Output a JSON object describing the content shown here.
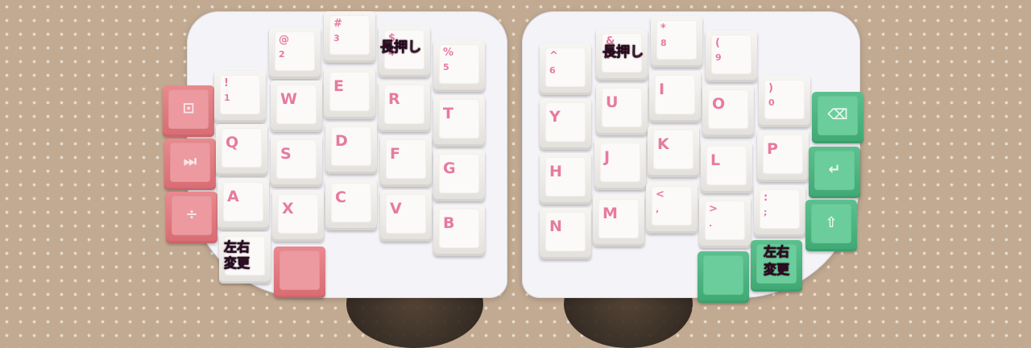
{
  "left_half": {
    "col1": [
      {
        "label": "!",
        "sub": "1"
      },
      {
        "label": "Q"
      },
      {
        "label": "A"
      }
    ],
    "col2": [
      {
        "label": "@",
        "sub": "2"
      },
      {
        "label": "W"
      },
      {
        "label": "S"
      },
      {
        "label": "X"
      }
    ],
    "col3": [
      {
        "label": "#",
        "sub": "3"
      },
      {
        "label": "E"
      },
      {
        "label": "D"
      },
      {
        "label": "C"
      }
    ],
    "col4": [
      {
        "label": "$",
        "sub": "4"
      },
      {
        "label": "R"
      },
      {
        "label": "F"
      },
      {
        "label": "V"
      }
    ],
    "col5": [
      {
        "label": "%",
        "sub": "5"
      },
      {
        "label": "T"
      },
      {
        "label": "G"
      },
      {
        "label": "B"
      }
    ],
    "modifier_icons": [
      "mode-icon",
      "media-icon",
      "divide-icon"
    ],
    "annotation_long_press": "長押し",
    "annotation_swap_line1": "左右",
    "annotation_swap_line2": "変更"
  },
  "right_half": {
    "col1": [
      {
        "label": "^",
        "sub": "6"
      },
      {
        "label": "Y"
      },
      {
        "label": "H"
      },
      {
        "label": "N"
      }
    ],
    "col2": [
      {
        "label": "&",
        "sub": "7"
      },
      {
        "label": "U"
      },
      {
        "label": "J"
      },
      {
        "label": "M"
      }
    ],
    "col3": [
      {
        "label": "*",
        "sub": "8"
      },
      {
        "label": "I"
      },
      {
        "label": "K"
      },
      {
        "label": "<",
        "sub": ","
      }
    ],
    "col4": [
      {
        "label": "(",
        "sub": "9"
      },
      {
        "label": "O"
      },
      {
        "label": "L"
      },
      {
        "label": ">",
        "sub": "."
      }
    ],
    "col5": [
      {
        "label": ")",
        "sub": "0"
      },
      {
        "label": "P"
      },
      {
        "label": ":",
        "sub": ";"
      }
    ],
    "modifier_icons": [
      "backspace-icon",
      "enter-icon",
      "shift-icon"
    ],
    "annotation_long_press": "長押し",
    "annotation_swap_line1": "左右",
    "annotation_swap_line2": "変更"
  },
  "colors": {
    "accent_pink": "#d86c72",
    "accent_green": "#3fa873",
    "legend_pink": "#e77aa0",
    "annotation_magenta": "#ff69d4"
  }
}
